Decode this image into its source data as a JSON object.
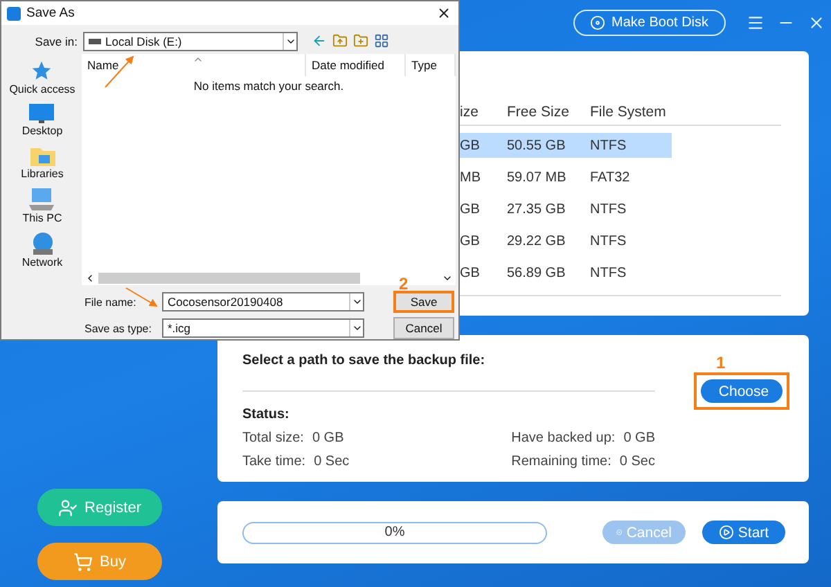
{
  "topbar": {
    "boot_button": "Make Boot Disk"
  },
  "sidebar": {
    "buttons": [
      {
        "label": "Register",
        "kind": "register"
      },
      {
        "label": "Buy",
        "kind": "buy"
      }
    ]
  },
  "partition_table": {
    "columns": [
      "ize",
      "Free Size",
      "File System"
    ],
    "rows": [
      {
        "cells": [
          "GB",
          "50.55 GB",
          "NTFS"
        ],
        "selected": true
      },
      {
        "cells": [
          "MB",
          "59.07 MB",
          "FAT32"
        ],
        "selected": false
      },
      {
        "cells": [
          "GB",
          "27.35 GB",
          "NTFS"
        ],
        "selected": false
      },
      {
        "cells": [
          "GB",
          "29.22 GB",
          "NTFS"
        ],
        "selected": false
      },
      {
        "cells": [
          "GB",
          "56.89 GB",
          "NTFS"
        ],
        "selected": false
      }
    ]
  },
  "backup": {
    "prompt": "Select a path to save the backup file:",
    "annotation": "1",
    "choose_button": "Choose",
    "status_title": "Status:",
    "stats": [
      {
        "label": "Total size:",
        "value": "0 GB"
      },
      {
        "label": "Have backed up:",
        "value": "0 GB"
      },
      {
        "label": "Take time:",
        "value": "0 Sec"
      },
      {
        "label": "Remaining time:",
        "value": "0 Sec"
      }
    ]
  },
  "progress": {
    "level": 0,
    "reading": "0%",
    "buttons": [
      {
        "label": "Cancel",
        "kind": "cancel",
        "disabled": true
      },
      {
        "label": "Start",
        "kind": "start",
        "disabled": false
      }
    ]
  },
  "dialog": {
    "title": "Save As",
    "save_in_label": "Save in:",
    "save_in_value": "Local Disk (E:)",
    "places": [
      {
        "label": "Quick access",
        "kind": "star"
      },
      {
        "label": "Desktop",
        "kind": "desktop"
      },
      {
        "label": "Libraries",
        "kind": "libraries"
      },
      {
        "label": "This PC",
        "kind": "pc"
      },
      {
        "label": "Network",
        "kind": "network"
      }
    ],
    "columns": [
      "Name",
      "Date modified",
      "Type"
    ],
    "empty_message": "No items match your search.",
    "file_name_label": "File name:",
    "file_name_value": "Cocosensor20190408",
    "type_label": "Save as type:",
    "type_value": "*.icg",
    "annotation": "2",
    "save_button": "Save",
    "cancel_button": "Cancel"
  }
}
